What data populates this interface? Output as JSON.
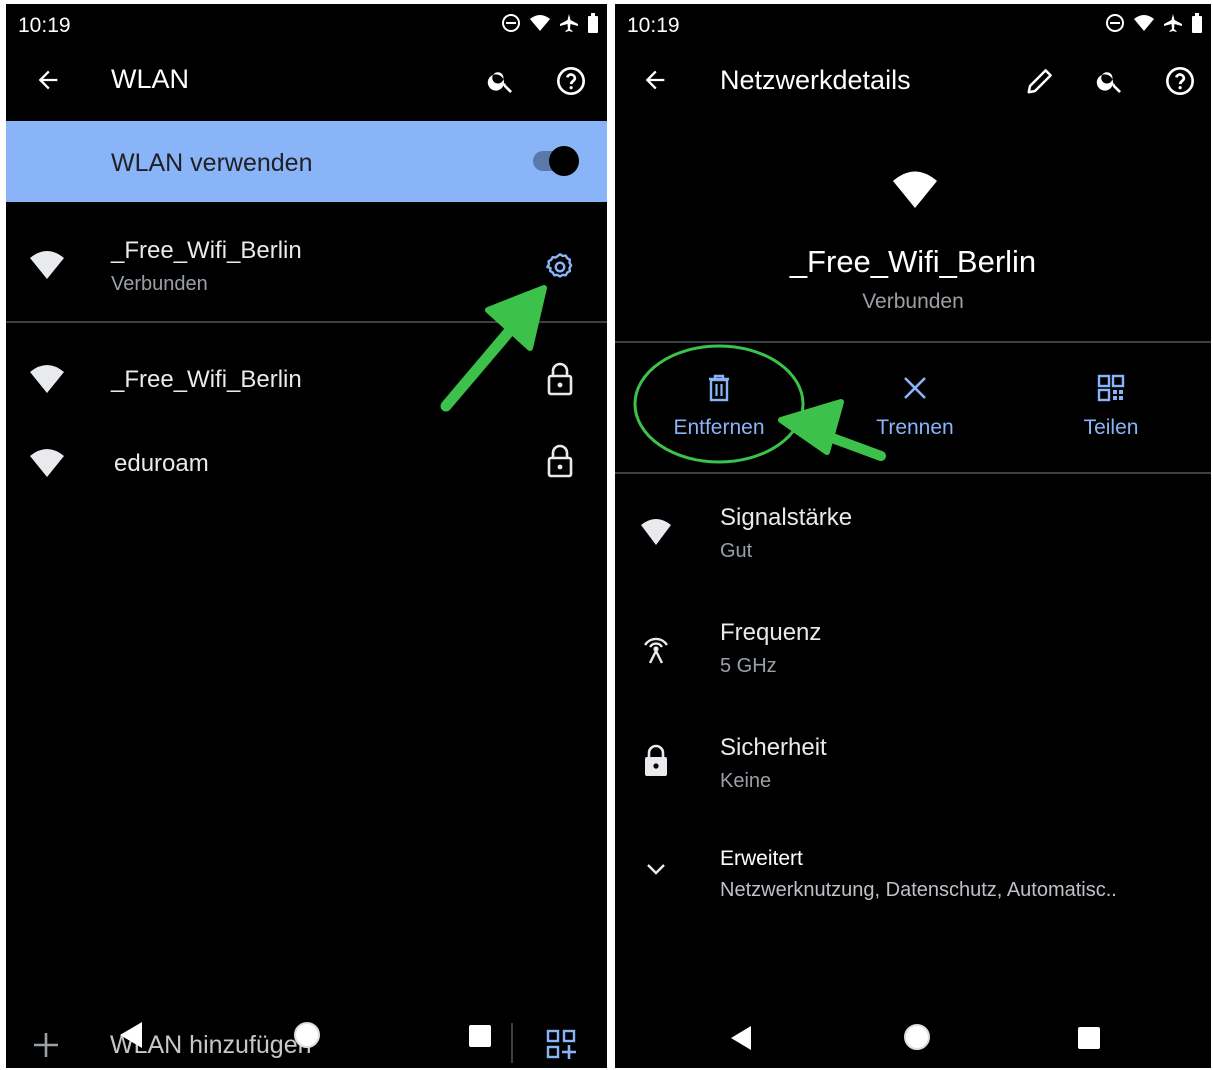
{
  "left": {
    "status_time": "10:19",
    "title": "WLAN",
    "toggle_label": "WLAN verwenden",
    "connected_network": {
      "name": "_Free_Wifi_Berlin",
      "status": "Verbunden"
    },
    "networks": [
      {
        "name": "_Free_Wifi_Berlin"
      },
      {
        "name": "eduroam"
      }
    ],
    "add_network_label": "WLAN hinzufügen"
  },
  "right": {
    "status_time": "10:19",
    "title": "Netzwerkdetails",
    "network_name": "_Free_Wifi_Berlin",
    "network_status": "Verbunden",
    "actions": [
      {
        "label": "Entfernen",
        "icon": "trash-icon"
      },
      {
        "label": "Trennen",
        "icon": "close-icon"
      },
      {
        "label": "Teilen",
        "icon": "qr-code-icon"
      }
    ],
    "details": [
      {
        "title": "Signalstärke",
        "value": "Gut",
        "icon": "wifi-icon"
      },
      {
        "title": "Frequenz",
        "value": "5 GHz",
        "icon": "antenna-icon"
      },
      {
        "title": "Sicherheit",
        "value": "Keine",
        "icon": "lock-icon"
      }
    ],
    "advanced": {
      "title": "Erweitert",
      "value": "Netzwerknutzung, Datenschutz, Automatisc.."
    }
  },
  "colors": {
    "accent": "#8ab4f8",
    "highlight_bar": "#8ab4f8",
    "annotation_green": "#3cc24a",
    "background": "#000000"
  }
}
